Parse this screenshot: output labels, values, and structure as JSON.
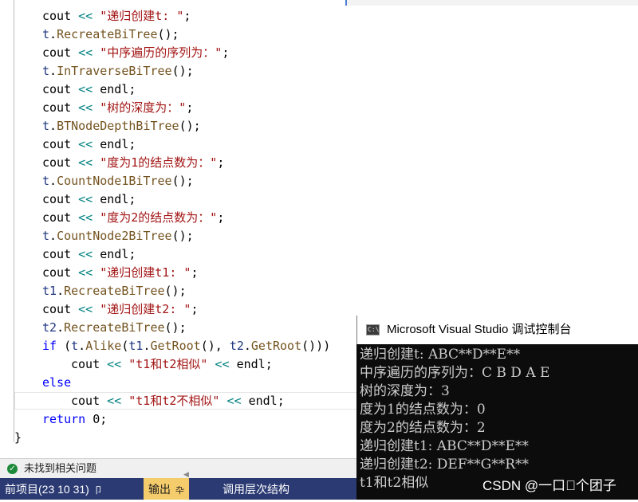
{
  "editor": {
    "lines": [
      {
        "indent": 1,
        "tokens": [
          {
            "t": "cout ",
            "c": "id"
          },
          {
            "t": "<< ",
            "c": "op"
          },
          {
            "t": "\"递归创建t: \"",
            "c": "str"
          },
          {
            "t": ";",
            "c": "id"
          }
        ]
      },
      {
        "indent": 1,
        "tokens": [
          {
            "t": "t",
            "c": "var"
          },
          {
            "t": ".",
            "c": "id"
          },
          {
            "t": "RecreateBiTree",
            "c": "fn"
          },
          {
            "t": "();",
            "c": "id"
          }
        ]
      },
      {
        "indent": 1,
        "tokens": [
          {
            "t": "cout ",
            "c": "id"
          },
          {
            "t": "<< ",
            "c": "op"
          },
          {
            "t": "\"中序遍历的序列为：\"",
            "c": "str"
          },
          {
            "t": ";",
            "c": "id"
          }
        ]
      },
      {
        "indent": 1,
        "tokens": [
          {
            "t": "t",
            "c": "var"
          },
          {
            "t": ".",
            "c": "id"
          },
          {
            "t": "InTraverseBiTree",
            "c": "fn"
          },
          {
            "t": "();",
            "c": "id"
          }
        ]
      },
      {
        "indent": 1,
        "tokens": [
          {
            "t": "cout ",
            "c": "id"
          },
          {
            "t": "<< ",
            "c": "op"
          },
          {
            "t": "endl",
            "c": "id"
          },
          {
            "t": ";",
            "c": "id"
          }
        ]
      },
      {
        "indent": 1,
        "tokens": [
          {
            "t": "cout ",
            "c": "id"
          },
          {
            "t": "<< ",
            "c": "op"
          },
          {
            "t": "\"树的深度为：\"",
            "c": "str"
          },
          {
            "t": ";",
            "c": "id"
          }
        ]
      },
      {
        "indent": 1,
        "tokens": [
          {
            "t": "t",
            "c": "var"
          },
          {
            "t": ".",
            "c": "id"
          },
          {
            "t": "BTNodeDepthBiTree",
            "c": "fn"
          },
          {
            "t": "();",
            "c": "id"
          }
        ]
      },
      {
        "indent": 1,
        "tokens": [
          {
            "t": "cout ",
            "c": "id"
          },
          {
            "t": "<< ",
            "c": "op"
          },
          {
            "t": "endl",
            "c": "id"
          },
          {
            "t": ";",
            "c": "id"
          }
        ]
      },
      {
        "indent": 1,
        "tokens": [
          {
            "t": "cout ",
            "c": "id"
          },
          {
            "t": "<< ",
            "c": "op"
          },
          {
            "t": "\"度为1的结点数为：\"",
            "c": "str"
          },
          {
            "t": ";",
            "c": "id"
          }
        ]
      },
      {
        "indent": 1,
        "tokens": [
          {
            "t": "t",
            "c": "var"
          },
          {
            "t": ".",
            "c": "id"
          },
          {
            "t": "CountNode1BiTree",
            "c": "fn"
          },
          {
            "t": "();",
            "c": "id"
          }
        ]
      },
      {
        "indent": 1,
        "tokens": [
          {
            "t": "cout ",
            "c": "id"
          },
          {
            "t": "<< ",
            "c": "op"
          },
          {
            "t": "endl",
            "c": "id"
          },
          {
            "t": ";",
            "c": "id"
          }
        ]
      },
      {
        "indent": 1,
        "tokens": [
          {
            "t": "cout ",
            "c": "id"
          },
          {
            "t": "<< ",
            "c": "op"
          },
          {
            "t": "\"度为2的结点数为：\"",
            "c": "str"
          },
          {
            "t": ";",
            "c": "id"
          }
        ]
      },
      {
        "indent": 1,
        "tokens": [
          {
            "t": "t",
            "c": "var"
          },
          {
            "t": ".",
            "c": "id"
          },
          {
            "t": "CountNode2BiTree",
            "c": "fn"
          },
          {
            "t": "();",
            "c": "id"
          }
        ]
      },
      {
        "indent": 1,
        "tokens": [
          {
            "t": "cout ",
            "c": "id"
          },
          {
            "t": "<< ",
            "c": "op"
          },
          {
            "t": "endl",
            "c": "id"
          },
          {
            "t": ";",
            "c": "id"
          }
        ]
      },
      {
        "indent": 1,
        "tokens": [
          {
            "t": "cout ",
            "c": "id"
          },
          {
            "t": "<< ",
            "c": "op"
          },
          {
            "t": "\"递归创建t1: \"",
            "c": "str"
          },
          {
            "t": ";",
            "c": "id"
          }
        ]
      },
      {
        "indent": 1,
        "tokens": [
          {
            "t": "t1",
            "c": "var"
          },
          {
            "t": ".",
            "c": "id"
          },
          {
            "t": "RecreateBiTree",
            "c": "fn"
          },
          {
            "t": "();",
            "c": "id"
          }
        ]
      },
      {
        "indent": 1,
        "tokens": [
          {
            "t": "cout ",
            "c": "id"
          },
          {
            "t": "<< ",
            "c": "op"
          },
          {
            "t": "\"递归创建t2: \"",
            "c": "str"
          },
          {
            "t": ";",
            "c": "id"
          }
        ]
      },
      {
        "indent": 1,
        "tokens": [
          {
            "t": "t2",
            "c": "var"
          },
          {
            "t": ".",
            "c": "id"
          },
          {
            "t": "RecreateBiTree",
            "c": "fn"
          },
          {
            "t": "();",
            "c": "id"
          }
        ]
      },
      {
        "indent": 1,
        "tokens": [
          {
            "t": "if ",
            "c": "kw"
          },
          {
            "t": "(",
            "c": "id"
          },
          {
            "t": "t",
            "c": "var"
          },
          {
            "t": ".",
            "c": "id"
          },
          {
            "t": "Alike",
            "c": "fn"
          },
          {
            "t": "(",
            "c": "id"
          },
          {
            "t": "t1",
            "c": "var"
          },
          {
            "t": ".",
            "c": "id"
          },
          {
            "t": "GetRoot",
            "c": "fn"
          },
          {
            "t": "(), ",
            "c": "id"
          },
          {
            "t": "t2",
            "c": "var"
          },
          {
            "t": ".",
            "c": "id"
          },
          {
            "t": "GetRoot",
            "c": "fn"
          },
          {
            "t": "()))",
            "c": "id"
          }
        ]
      },
      {
        "indent": 2,
        "tokens": [
          {
            "t": "cout ",
            "c": "id"
          },
          {
            "t": "<< ",
            "c": "op"
          },
          {
            "t": "\"t1和t2相似\"",
            "c": "str"
          },
          {
            "t": " ",
            "c": "id"
          },
          {
            "t": "<< ",
            "c": "op"
          },
          {
            "t": "endl",
            "c": "id"
          },
          {
            "t": ";",
            "c": "id"
          }
        ]
      },
      {
        "indent": 1,
        "tokens": [
          {
            "t": "else",
            "c": "kw"
          }
        ]
      },
      {
        "indent": 2,
        "tokens": [
          {
            "t": "cout ",
            "c": "id"
          },
          {
            "t": "<< ",
            "c": "op"
          },
          {
            "t": "\"t1和t2不相似\"",
            "c": "str"
          },
          {
            "t": " ",
            "c": "id"
          },
          {
            "t": "<< ",
            "c": "op"
          },
          {
            "t": "endl",
            "c": "id"
          },
          {
            "t": ";",
            "c": "id"
          }
        ]
      },
      {
        "indent": 1,
        "tokens": [
          {
            "t": "return ",
            "c": "kw"
          },
          {
            "t": "0",
            "c": "id"
          },
          {
            "t": ";",
            "c": "id"
          }
        ]
      },
      {
        "indent": 0,
        "tokens": [
          {
            "t": "}",
            "c": "brace"
          }
        ]
      }
    ]
  },
  "status": {
    "message": "未找到相关问题"
  },
  "bottom_tabs": [
    {
      "label": "前项目(23 10 31)",
      "pin": "卩",
      "active": false
    },
    {
      "label": "输出",
      "pin": "卆",
      "active": true
    },
    {
      "label": "调用层次结构",
      "pin": "",
      "active": false
    }
  ],
  "console": {
    "title": "Microsoft Visual Studio 调试控制台",
    "icon_label": "C:\\",
    "lines": [
      "递归创建t: ABC**D**E**",
      "中序遍历的序列为：C B D A E",
      "树的深度为：3",
      "度为1的结点数为：0",
      "度为2的结点数为：2",
      "递归创建t1: ABC**D**E**",
      "递归创建t2: DEF**G**R**",
      "t1和t2相似"
    ],
    "watermark": "CSDN @一口\u0000个团子"
  },
  "colors": {
    "keyword": "#0000ff",
    "operator": "#008080",
    "function": "#74531f",
    "variable": "#1f377f",
    "string": "#a31515",
    "tab_bar": "#2b3a73",
    "active_tab": "#f5cc6b",
    "console_bg": "#0c0c0c"
  }
}
